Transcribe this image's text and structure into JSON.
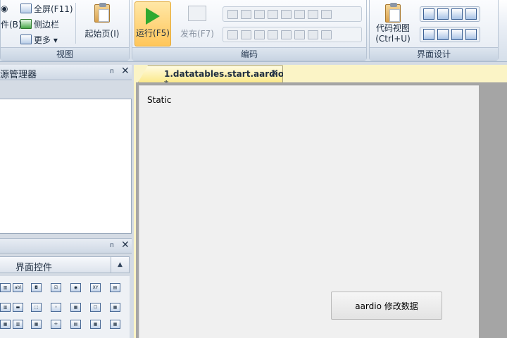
{
  "ribbon": {
    "view_group": {
      "label": "视图",
      "partial_top": "◉",
      "partial_mid": "件(B)",
      "fullscreen": "全屏(F11)",
      "sidebar": "侧边栏",
      "more": "更多 ▾",
      "start_page": "起始页(I)"
    },
    "code_group": {
      "label": "编码",
      "run": "运行(F5)",
      "publish": "发布(F7)",
      "code_view": "代码视图",
      "code_view_shortcut": "(Ctrl+U)"
    },
    "ui_group": {
      "label": "界面设计"
    }
  },
  "left": {
    "resource_panel_title": "源管理器",
    "pin": "ᴨ",
    "close": "✕",
    "controls_panel_header": "界面控件",
    "scroll_up": "▲",
    "controls": [
      "▥",
      "abl",
      "◘",
      "☑",
      "◉",
      "XY",
      "▤",
      "▥",
      "▬",
      "⬚",
      "⁘",
      "▦",
      "☐",
      "▦",
      "▦",
      "▥",
      "▦",
      "✛",
      "▤",
      "▦",
      "▦"
    ]
  },
  "document": {
    "tab_title": "1.datatables.start.aardio *",
    "tab_close": "✕",
    "static_label": "Static",
    "button_label": "aardio 修改数据"
  },
  "colors": {
    "accent_active": "#ffc65a",
    "tab_yellow": "#fbe98a",
    "form_bg": "#f0f0f0"
  }
}
